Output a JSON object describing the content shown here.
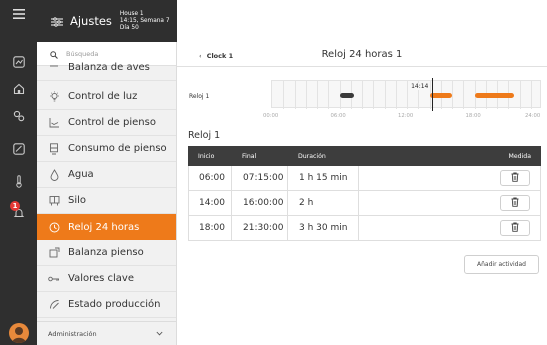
{
  "header": {
    "title": "Ajustes",
    "house": "House 1",
    "datetime": "14:15, Semana 7 Día 50"
  },
  "search": {
    "placeholder": "Búsqueda"
  },
  "rail": {
    "notification_count": "1"
  },
  "menu": {
    "items": [
      {
        "label": "Balanza de aves",
        "icon": "scale-icon"
      },
      {
        "label": "Control de luz",
        "icon": "bulb-icon"
      },
      {
        "label": "Control de pienso",
        "icon": "feed-chart-icon"
      },
      {
        "label": "Consumo de pienso",
        "icon": "feed-hopper-icon"
      },
      {
        "label": "Agua",
        "icon": "water-drop-icon"
      },
      {
        "label": "Silo",
        "icon": "silo-icon"
      },
      {
        "label": "Reloj 24 horas",
        "icon": "clock-icon",
        "active": true
      },
      {
        "label": "Balanza pienso",
        "icon": "feed-scale-icon"
      },
      {
        "label": "Valores clave",
        "icon": "key-icon"
      },
      {
        "label": "Estado producción",
        "icon": "production-icon"
      }
    ],
    "admin_label": "Administración"
  },
  "page": {
    "back_label": "Clock 1",
    "title": "Reloj 24 horas 1"
  },
  "timeline": {
    "label": "Reloj 1",
    "now_label": "14:14",
    "now_hour": 14.23,
    "hour_labels": [
      "00:00",
      "06:00",
      "12:00",
      "18:00",
      "24:00"
    ],
    "periods": [
      {
        "start": 6.0,
        "end": 7.25,
        "color": "#3a3a3a"
      },
      {
        "start": 14.0,
        "end": 16.0,
        "color": "#ee7a1a"
      },
      {
        "start": 18.0,
        "end": 21.5,
        "color": "#ee7a1a"
      }
    ]
  },
  "section": {
    "title": "Reloj 1"
  },
  "table": {
    "headers": {
      "start": "Inicio",
      "end": "Final",
      "duration": "Duración",
      "action": "Medida"
    },
    "rows": [
      {
        "start": "06:00",
        "end": "07:15:00",
        "duration": "1 h 15 min"
      },
      {
        "start": "14:00",
        "end": "16:00:00",
        "duration": "2 h"
      },
      {
        "start": "18:00",
        "end": "21:30:00",
        "duration": "3 h 30 min"
      }
    ]
  },
  "add_button": "Añadir actividad",
  "colors": {
    "accent": "#ee7a1a",
    "dark": "#2f2f2f",
    "header": "#3d3d3d"
  }
}
